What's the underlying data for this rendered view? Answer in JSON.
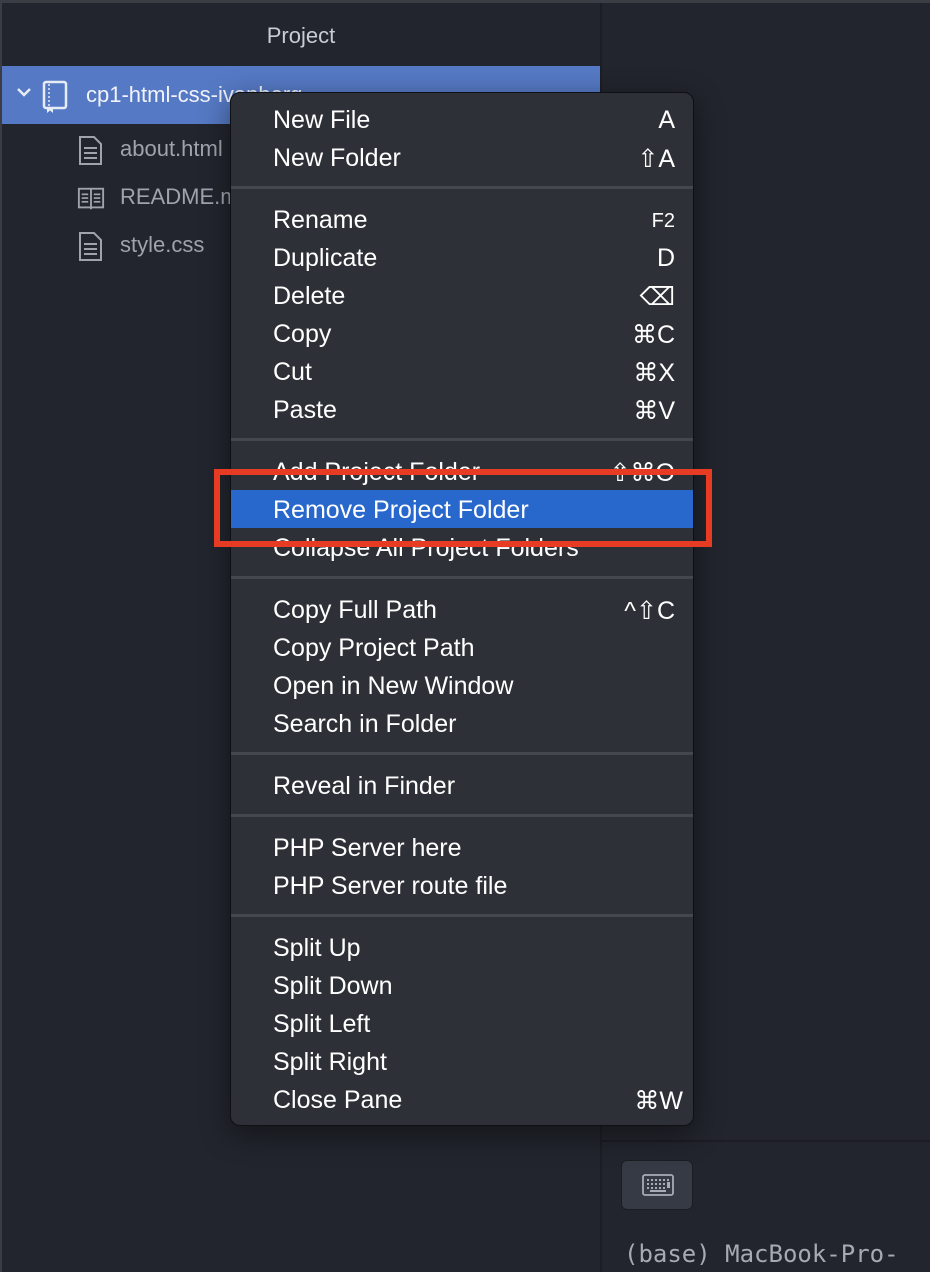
{
  "sidebar": {
    "title": "Project",
    "root_folder": "cp1-html-css-ivanberg",
    "files": [
      {
        "name": "about.html",
        "icon": "file-text-icon"
      },
      {
        "name": "README.md",
        "icon": "book-open-icon"
      },
      {
        "name": "style.css",
        "icon": "file-text-icon"
      }
    ]
  },
  "context_menu": {
    "groups": [
      [
        {
          "label": "New File",
          "shortcut": "A"
        },
        {
          "label": "New Folder",
          "shortcut": "⇧A"
        }
      ],
      [
        {
          "label": "Rename",
          "shortcut": "F2"
        },
        {
          "label": "Duplicate",
          "shortcut": "D"
        },
        {
          "label": "Delete",
          "shortcut": "⌫"
        },
        {
          "label": "Copy",
          "shortcut": "⌘C"
        },
        {
          "label": "Cut",
          "shortcut": "⌘X"
        },
        {
          "label": "Paste",
          "shortcut": "⌘V"
        }
      ],
      [
        {
          "label": "Add Project Folder",
          "shortcut": "⇧⌘O"
        },
        {
          "label": "Remove Project Folder",
          "shortcut": "",
          "highlighted": true
        },
        {
          "label": "Collapse All Project Folders",
          "shortcut": ""
        }
      ],
      [
        {
          "label": "Copy Full Path",
          "shortcut": "^⇧C"
        },
        {
          "label": "Copy Project Path",
          "shortcut": ""
        },
        {
          "label": "Open in New Window",
          "shortcut": ""
        },
        {
          "label": "Search in Folder",
          "shortcut": ""
        }
      ],
      [
        {
          "label": "Reveal in Finder",
          "shortcut": ""
        }
      ],
      [
        {
          "label": "PHP Server here",
          "shortcut": ""
        },
        {
          "label": "PHP Server route file",
          "shortcut": ""
        }
      ],
      [
        {
          "label": "Split Up",
          "shortcut": ""
        },
        {
          "label": "Split Down",
          "shortcut": ""
        },
        {
          "label": "Split Left",
          "shortcut": ""
        },
        {
          "label": "Split Right",
          "shortcut": ""
        },
        {
          "label": "Close Pane",
          "shortcut": "⌘W"
        }
      ]
    ],
    "highlight_color": "#2868cc"
  },
  "annotation": {
    "color": "#e83b24",
    "target": "Remove Project Folder"
  },
  "terminal": {
    "keyboard_button_icon": "keyboard-icon",
    "prompt_text": "(base) MacBook-Pro-"
  }
}
